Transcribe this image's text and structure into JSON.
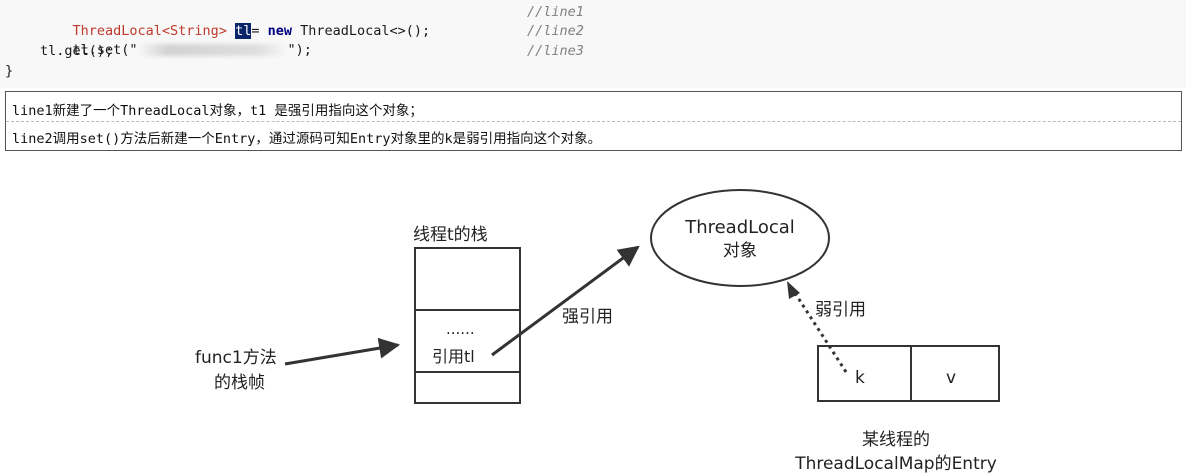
{
  "code": {
    "line1": {
      "type": "ThreadLocal<String>",
      "var": "tl",
      "rest_a": "= ",
      "new_kw": "new",
      "rest_b": " ThreadLocal<>();",
      "comment": "//line1"
    },
    "line2": {
      "start": "tl.set(\"",
      "end": "\");",
      "comment": "//line2"
    },
    "line3": {
      "text": "tl.get();",
      "comment": "//line3"
    },
    "closing_brace": "}"
  },
  "explanation": [
    "line1新建了一个ThreadLocal对象，t1 是强引用指向这个对象；",
    "line2调用set()方法后新建一个Entry，通过源码可知Entry对象里的k是弱引用指向这个对象。"
  ],
  "diagram": {
    "stack_title": "线程t的栈",
    "stack_dots": "......",
    "stack_ref": "引用tl",
    "frame_label_1": "func1方法",
    "frame_label_2": "的栈帧",
    "strong_ref_label": "强引用",
    "threadlocal_object_1": "ThreadLocal",
    "threadlocal_object_2": "对象",
    "weak_ref_label": "弱引用",
    "entry_key": "k",
    "entry_value": "v",
    "entry_caption_1": "某线程的",
    "entry_caption_2": "ThreadLocalMap的Entry"
  }
}
